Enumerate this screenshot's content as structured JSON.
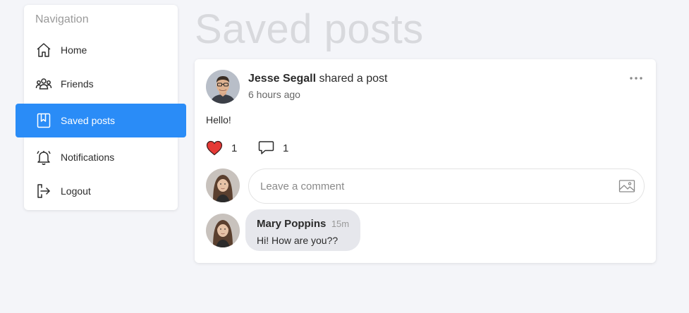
{
  "sidebar": {
    "title": "Navigation",
    "items": [
      {
        "label": "Home",
        "icon": "home-icon"
      },
      {
        "label": "Friends",
        "icon": "friends-icon"
      },
      {
        "label": "Saved posts",
        "icon": "bookmark-icon",
        "active": true
      },
      {
        "label": "Notifications",
        "icon": "bell-icon"
      },
      {
        "label": "Logout",
        "icon": "logout-icon"
      }
    ]
  },
  "page": {
    "title": "Saved posts"
  },
  "post": {
    "author": "Jesse Segall",
    "action": " shared a post",
    "time": "6 hours ago",
    "content": "Hello!",
    "likes": "1",
    "comments_count": "1",
    "comment_placeholder": "Leave a comment",
    "comments": [
      {
        "author": "Mary Poppins",
        "time": "15m",
        "text": "Hi! How are you??"
      }
    ]
  },
  "colors": {
    "accent": "#2a8cf7",
    "background": "#f4f5f9",
    "heart": "#e53935",
    "comment_bubble": "#e6e7ec"
  }
}
